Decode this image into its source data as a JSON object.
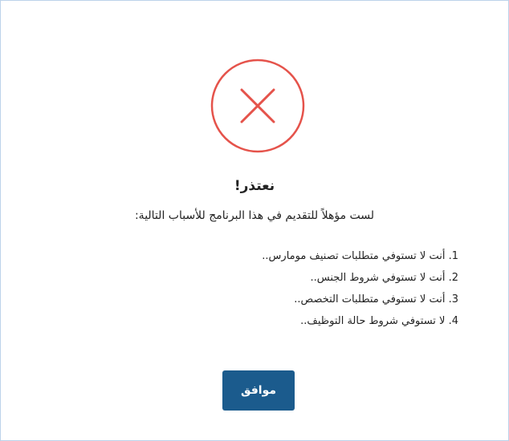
{
  "dialog": {
    "icon": "close-circle-icon",
    "icon_color": "#e5534b",
    "title": "نعتذر!",
    "subtitle": "لست مؤهلاً للتقديم في هذا البرنامج للأسباب التالية:",
    "reasons": [
      "1. أنت لا تستوفي متطلبات تصنيف مومارس..",
      "2. أنت لا تستوفي شروط الجنس..",
      "3. أنت لا تستوفي متطلبات التخصص..",
      "4. لا تستوفي شروط حالة التوظيف.."
    ],
    "ok_label": "موافق",
    "button_color": "#1b5b8d"
  }
}
